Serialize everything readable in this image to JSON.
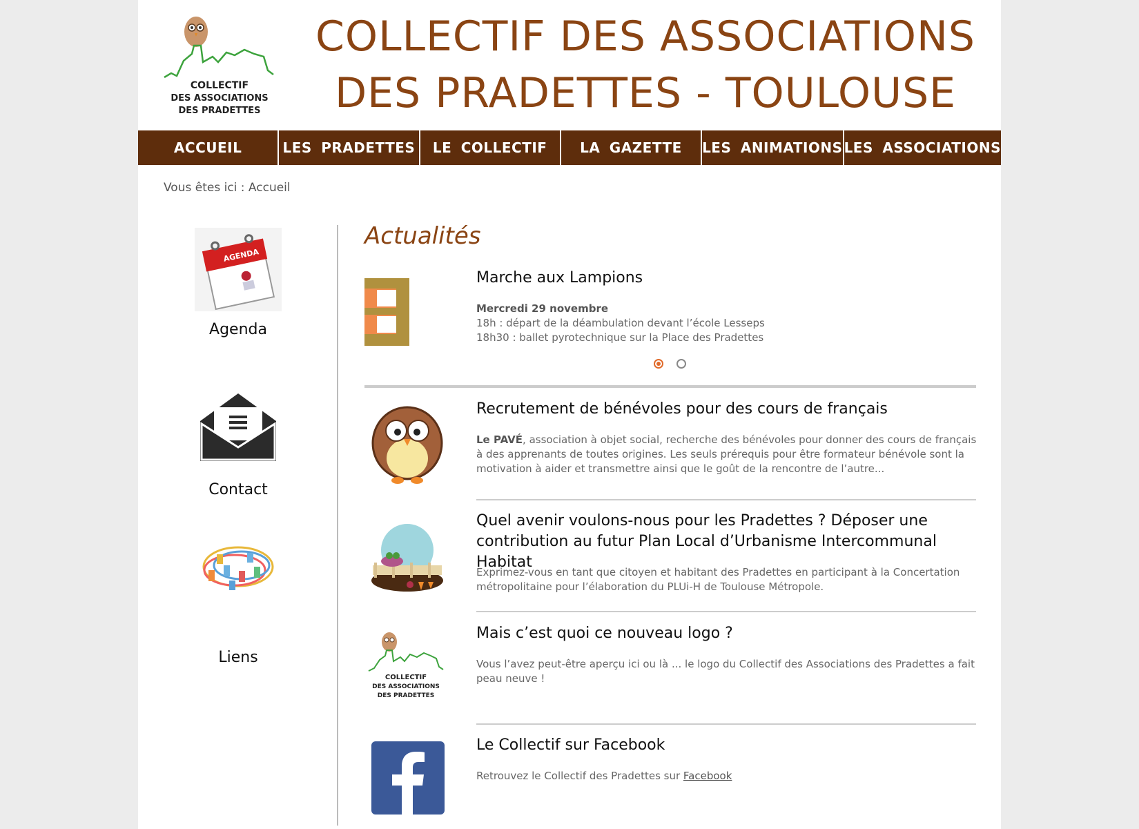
{
  "header": {
    "title_line1": "COLLECTIF DES ASSOCIATIONS",
    "title_line2": "DES PRADETTES - TOULOUSE",
    "logo_text": [
      "COLLECTIF",
      "DES ASSOCIATIONS",
      "DES PRADETTES"
    ]
  },
  "nav": [
    "ACCUEIL",
    "LES PRADETTES",
    "LE COLLECTIF",
    "LA GAZETTE",
    "LES ANIMATIONS",
    "LES ASSOCIATIONS"
  ],
  "breadcrumb": "Vous êtes ici : Accueil",
  "sidebar": {
    "agenda": {
      "label": "Agenda",
      "badge": "AGENDA"
    },
    "contact": {
      "label": "Contact"
    },
    "liens": {
      "label": "Liens"
    }
  },
  "news": {
    "heading": "Actualités",
    "slider": {
      "title": "Marche aux Lampions",
      "date": "Mercredi 29 novembre",
      "line1": "18h : départ de la déambulation devant l’école Lesseps",
      "line2": "18h30 : ballet pyrotechnique sur la Place des Pradettes",
      "active_slide": 1,
      "slide_count": 2
    },
    "articles": [
      {
        "title": "Recrutement de bénévoles pour des cours de français",
        "lead": "Le PAVÉ",
        "text": ", association à objet social, recherche des bénévoles pour donner des cours de français à des apprenants de toutes origines. Les seuls prérequis pour être formateur bénévole sont la motivation à aider et transmettre ainsi que le goût de la rencontre de l’autre..."
      },
      {
        "title": "Quel avenir voulons-nous pour les Pradettes ? Déposer une contribution au futur Plan Local d’Urbanisme Intercommunal Habitat",
        "text": "Exprimez-vous en tant que citoyen et habitant des Pradettes en participant à la Concertation métropolitaine pour l’élaboration du PLUi-H de Toulouse Métropole."
      },
      {
        "title": "Mais c’est quoi ce nouveau logo ?",
        "text": "Vous l’avez peut-être aperçu ici ou là ... le logo du Collectif des Associations des Pradettes a fait peau neuve !"
      },
      {
        "title": "Le Collectif sur Facebook",
        "text": "Retrouvez le Collectif des Pradettes sur ",
        "link": "Facebook"
      }
    ]
  },
  "colors": {
    "brand_brown": "#8a4413",
    "nav_bg": "#5e2d0c",
    "accent_orange": "#e06a2a"
  }
}
